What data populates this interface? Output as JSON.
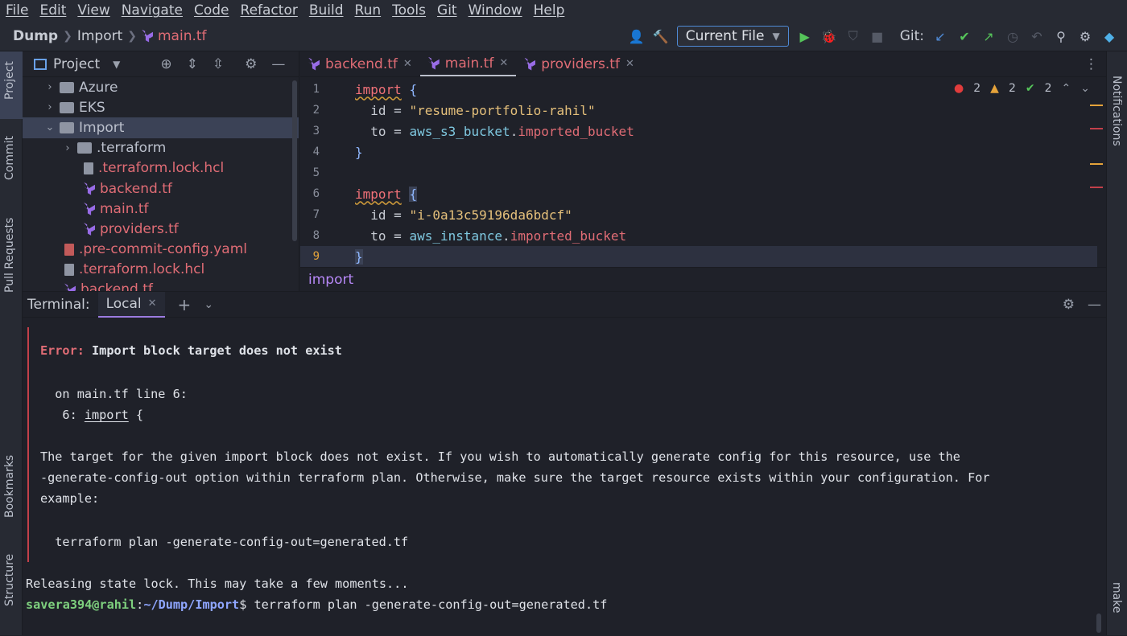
{
  "menu": [
    "File",
    "Edit",
    "View",
    "Navigate",
    "Code",
    "Refactor",
    "Build",
    "Run",
    "Tools",
    "Git",
    "Window",
    "Help"
  ],
  "breadcrumb": {
    "root": "Dump",
    "folder": "Import",
    "file": "main.tf"
  },
  "toolbar": {
    "run_config": "Current File",
    "git_label": "Git:"
  },
  "left_strip": {
    "project": "Project",
    "commit": "Commit",
    "pull_requests": "Pull Requests",
    "bookmarks": "Bookmarks",
    "structure": "Structure"
  },
  "right_strip": {
    "notifications": "Notifications",
    "make": "make"
  },
  "project": {
    "title": "Project",
    "items": [
      {
        "label": "Azure"
      },
      {
        "label": "EKS"
      },
      {
        "label": "Import"
      },
      {
        "label": ".terraform"
      },
      {
        "label": ".terraform.lock.hcl"
      },
      {
        "label": "backend.tf"
      },
      {
        "label": "main.tf"
      },
      {
        "label": "providers.tf"
      },
      {
        "label": ".pre-commit-config.yaml"
      },
      {
        "label": ".terraform.lock.hcl"
      },
      {
        "label": "backend.tf"
      }
    ]
  },
  "editor": {
    "tabs": [
      {
        "label": "backend.tf"
      },
      {
        "label": "main.tf"
      },
      {
        "label": "providers.tf"
      }
    ],
    "inspections": {
      "errors": "2",
      "warnings": "2",
      "ok": "2"
    },
    "line_numbers": [
      "1",
      "2",
      "3",
      "4",
      "5",
      "6",
      "7",
      "8",
      "9"
    ],
    "code": {
      "kw1": "import",
      "b1": "{",
      "id_attr": "id",
      "eq": "=",
      "id1": "\"resume-portfolio-rahil\"",
      "to_attr": "to",
      "res1": "aws_s3_bucket",
      "dot": ".",
      "ref1": "imported_bucket",
      "close": "}",
      "kw2": "import",
      "b2": "{",
      "id2": "\"i-0a13c59196da6bdcf\"",
      "res2": "aws_instance",
      "ref2": "imported_bucket"
    },
    "breadcrumb": "import"
  },
  "terminal": {
    "label": "Terminal:",
    "tab": "Local",
    "error_prefix": "Error:",
    "error_title": "Import block target does not exist",
    "on_line": "  on main.tf line 6:",
    "code_prefix": "   6: ",
    "code_kw": "import",
    "code_suffix": " {",
    "msg1": "The target for the given import block does not exist. If you wish to automatically generate config for this resource, use the",
    "msg2": "-generate-config-out option within terraform plan. Otherwise, make sure the target resource exists within your configuration. For",
    "msg3": "example:",
    "cmd_example": "  terraform plan -generate-config-out=generated.tf",
    "release": "Releasing state lock. This may take a few moments...",
    "prompt_user": "savera394@rahil",
    "prompt_colon": ":",
    "prompt_path": "~/Dump/Import",
    "prompt_dollar": "$ ",
    "command": "terraform plan -generate-config-out=generated.tf"
  },
  "colors": {
    "error": "#e06c75",
    "accent": "#4f8ad6",
    "purple": "#b788f7"
  }
}
